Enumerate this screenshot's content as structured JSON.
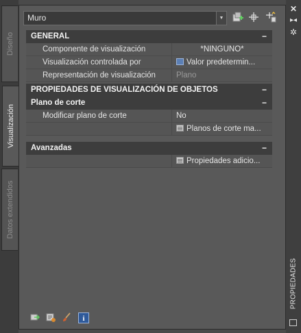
{
  "side_tabs": [
    {
      "label": "Diseño",
      "active": false
    },
    {
      "label": "Visualización",
      "active": true
    },
    {
      "label": "Datos extendidos",
      "active": false
    }
  ],
  "style_selector": {
    "value": "Muro"
  },
  "palette_title": "PROPIEDADES",
  "icons": {
    "add_style": "add-style-icon",
    "select_objects": "select-objects-icon",
    "quick_select": "quick-select-icon",
    "close": "close-icon",
    "autohide": "autohide-icon",
    "settings": "settings-icon",
    "bottom": [
      "edit-display-icon",
      "display-properties-icon",
      "brush-icon",
      "info-icon"
    ]
  },
  "sections": {
    "general": {
      "title": "GENERAL",
      "collapse": "−",
      "rows": [
        {
          "name": "Componente de visualización",
          "value": "*NINGUNO*"
        },
        {
          "name": "Visualización controlada por",
          "value": "Valor  predetermin..."
        },
        {
          "name": "Representación de visualización",
          "value": "Plano"
        }
      ]
    },
    "object_display": {
      "title": "PROPIEDADES DE VISUALIZACIÓN DE OBJETOS",
      "collapse": "−"
    },
    "cut_plane": {
      "title": "Plano de corte",
      "collapse": "−",
      "rows": [
        {
          "name": "Modificar plano de corte",
          "value": "No"
        },
        {
          "name": "",
          "value": "Planos de corte ma..."
        }
      ]
    },
    "advanced": {
      "title": "Avanzadas",
      "collapse": "−",
      "rows": [
        {
          "name": "",
          "value": "Propiedades  adicio..."
        }
      ]
    }
  }
}
